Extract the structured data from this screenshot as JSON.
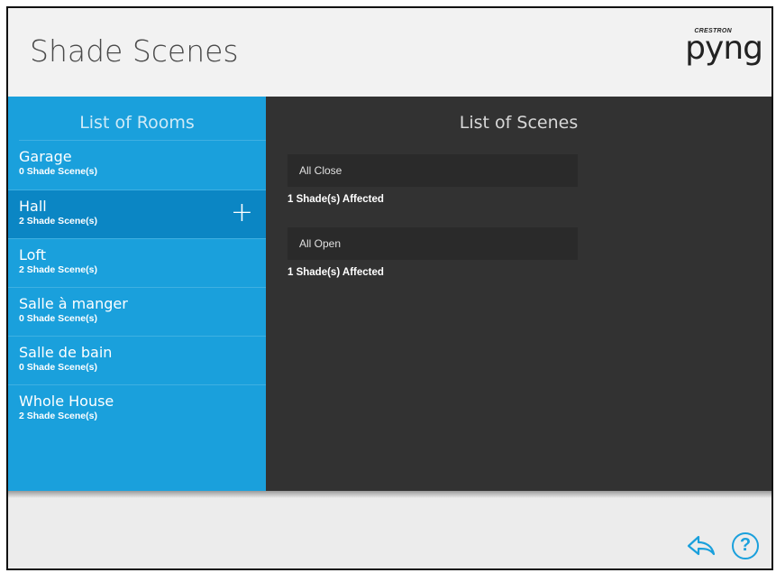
{
  "header": {
    "title": "Shade Scenes",
    "logo_brand": "CRESTRON",
    "logo_word": "pyng"
  },
  "rooms_panel": {
    "title": "List of Rooms",
    "items": [
      {
        "name": "Garage",
        "count": "0 Shade Scene(s)",
        "selected": false
      },
      {
        "name": "Hall",
        "count": "2 Shade Scene(s)",
        "selected": true
      },
      {
        "name": "Loft",
        "count": "2 Shade Scene(s)",
        "selected": false
      },
      {
        "name": "Salle à manger",
        "count": "0 Shade Scene(s)",
        "selected": false
      },
      {
        "name": "Salle de bain",
        "count": "0 Shade Scene(s)",
        "selected": false
      },
      {
        "name": "Whole House",
        "count": "2 Shade Scene(s)",
        "selected": false
      }
    ]
  },
  "scenes_panel": {
    "title": "List of Scenes",
    "items": [
      {
        "name": "All Close",
        "affected": "1 Shade(s) Affected"
      },
      {
        "name": "All Open",
        "affected": "1 Shade(s) Affected"
      }
    ]
  },
  "footer": {
    "back_icon": "back-arrow-icon",
    "help_label": "?"
  },
  "colors": {
    "accent": "#1aa0dc",
    "selected_room": "#0b86c4",
    "scenes_bg": "#323232"
  }
}
